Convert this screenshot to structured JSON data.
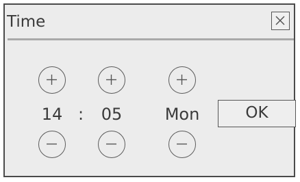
{
  "dialog": {
    "title": "Time",
    "close_icon": "close-x-icon"
  },
  "fields": {
    "hour": "14",
    "separator": ":",
    "minute": "05",
    "day": "Mon"
  },
  "buttons": {
    "increment_icon": "plus-icon",
    "decrement_icon": "minus-icon",
    "ok_label": "OK"
  }
}
